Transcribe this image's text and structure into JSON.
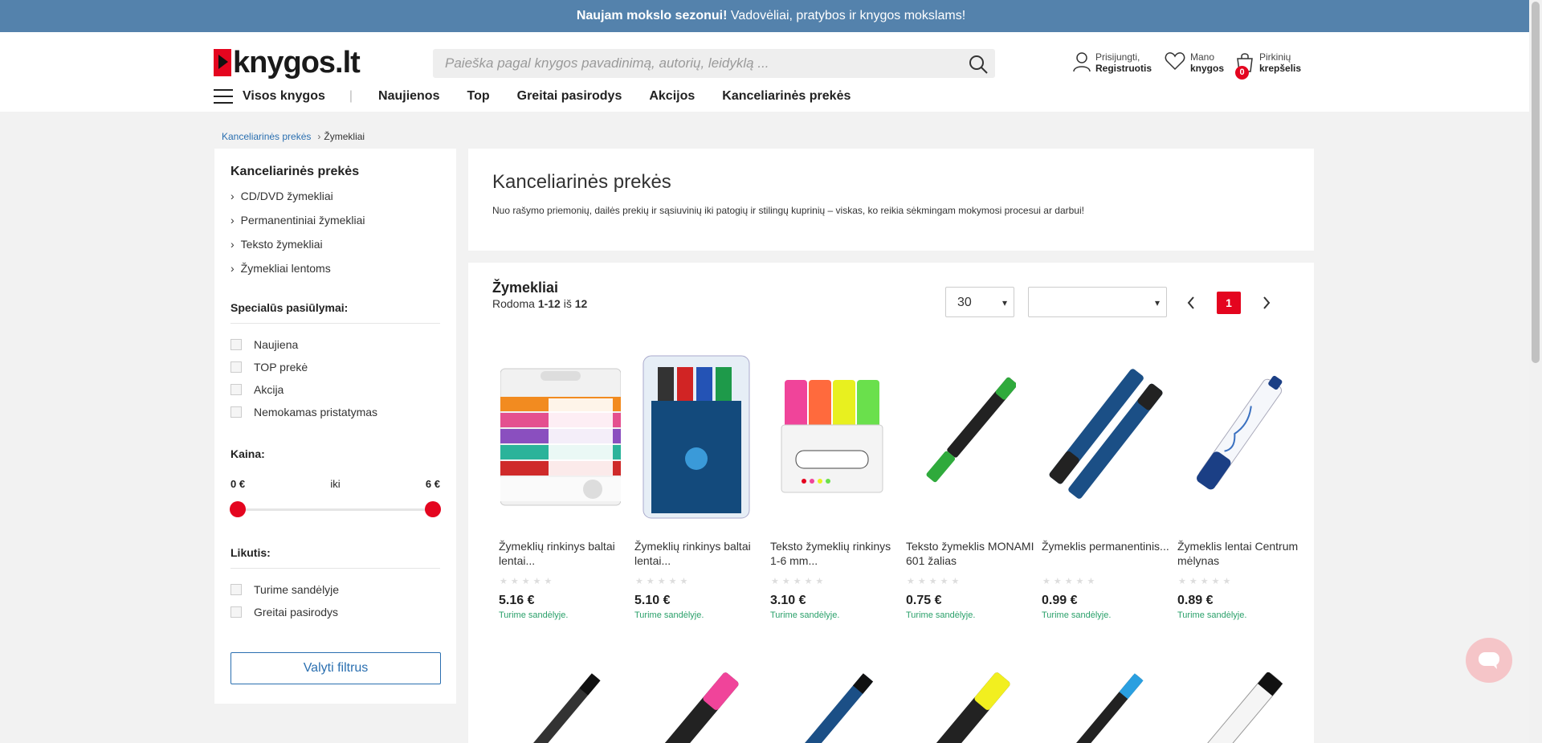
{
  "promo": {
    "bold": "Naujam mokslo sezonui!",
    "text": " Vadovėliai, pratybos ir knygos mokslams!"
  },
  "header": {
    "logo_text": "knygos.lt",
    "search_placeholder": "Paieška pagal knygos pavadinimą, autorių, leidyklą ...",
    "login_line1": "Prisijungti,",
    "login_line2": "Registruotis",
    "wishlist_line1": "Mano",
    "wishlist_line2": "knygos",
    "cart_line1": "Pirkinių",
    "cart_line2": "krepšelis",
    "cart_count": "0"
  },
  "nav": {
    "all_books": "Visos knygos",
    "items": [
      "Naujienos",
      "Top",
      "Greitai pasirodys",
      "Akcijos",
      "Kanceliarinės prekės"
    ]
  },
  "breadcrumb": {
    "parent": "Kanceliarinės prekės",
    "current": "Žymekliai"
  },
  "sidebar": {
    "title": "Kanceliarinės prekės",
    "categories": [
      "CD/DVD žymekliai",
      "Permanentiniai žymekliai",
      "Teksto žymekliai",
      "Žymekliai lentoms"
    ],
    "special_title": "Specialūs pasiūlymai:",
    "special": [
      "Naujiena",
      "TOP prekė",
      "Akcija",
      "Nemokamas pristatymas"
    ],
    "price_title": "Kaina:",
    "price_min": "0 €",
    "price_sep": "iki",
    "price_max": "6 €",
    "price_range": [
      0,
      6
    ],
    "stock_title": "Likutis:",
    "stock": [
      "Turime sandėlyje",
      "Greitai pasirodys"
    ],
    "clear_label": "Valyti filtrus"
  },
  "intro": {
    "title": "Kanceliarinės prekės",
    "text": "Nuo rašymo priemonių, dailės prekių ir sąsiuvinių iki patogių ir stilingų kuprinių – viskas, ko reikia sėkmingam mokymosi procesui ar darbui!"
  },
  "listing": {
    "title": "Žymekliai",
    "count_prefix": "Rodoma ",
    "count_range": "1-12",
    "count_mid": " iš ",
    "count_total": "12",
    "per_page": "30",
    "sort": "",
    "current_page": "1"
  },
  "products": [
    {
      "name": "Žymeklių rinkinys baltai lentai...",
      "price": "5.16 €",
      "stock": "Turime sandėlyje."
    },
    {
      "name": "Žymeklių rinkinys baltai lentai...",
      "price": "5.10 €",
      "stock": "Turime sandėlyje."
    },
    {
      "name": "Teksto žymeklių rinkinys 1-6 mm...",
      "price": "3.10 €",
      "stock": "Turime sandėlyje."
    },
    {
      "name": "Teksto žymeklis MONAMI 601 žalias",
      "price": "0.75 €",
      "stock": "Turime sandėlyje."
    },
    {
      "name": "Žymeklis permanentinis...",
      "price": "0.99 €",
      "stock": "Turime sandėlyje."
    },
    {
      "name": "Žymeklis lentai Centrum mėlynas",
      "price": "0.89 €",
      "stock": "Turime sandėlyje."
    }
  ],
  "colors": {
    "brand_red": "#e4051f",
    "promo_blue": "#5482ac",
    "link_blue": "#2a6fb0",
    "stock_green": "#2aa06a"
  },
  "icons": [
    "user-icon",
    "heart-icon",
    "cart-icon",
    "search-icon",
    "menu-icon",
    "chat-icon"
  ]
}
